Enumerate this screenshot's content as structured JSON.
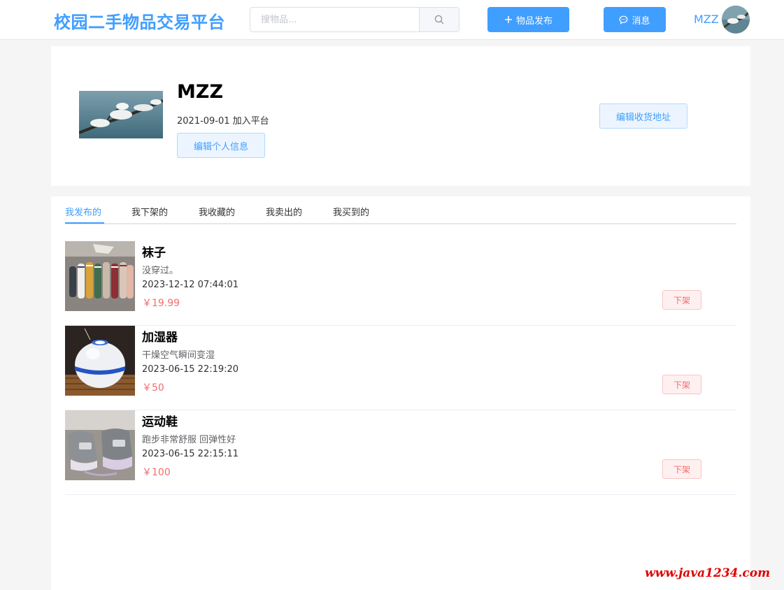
{
  "header": {
    "logo": "校园二手物品交易平台",
    "search_placeholder": "搜物品...",
    "publish_label": "物品发布",
    "message_label": "消息",
    "username": "MZZ"
  },
  "profile": {
    "name": "MZZ",
    "joined": "2021-09-01 加入平台",
    "edit_info_label": "编辑个人信息",
    "edit_address_label": "编辑收货地址"
  },
  "tabs": [
    "我发布的",
    "我下架的",
    "我收藏的",
    "我卖出的",
    "我买到的"
  ],
  "items": [
    {
      "title": "袜子",
      "desc": "没穿过。",
      "time": "2023-12-12 07:44:01",
      "price": "￥19.99",
      "action": "下架"
    },
    {
      "title": "加湿器",
      "desc": "干燥空气瞬间变湿",
      "time": "2023-06-15 22:19:20",
      "price": "￥50",
      "action": "下架"
    },
    {
      "title": "运动鞋",
      "desc": "跑步非常舒服 回弹性好",
      "time": "2023-06-15 22:15:11",
      "price": "￥100",
      "action": "下架"
    }
  ],
  "watermark": "www.java1234.com",
  "colors": {
    "primary": "#409eff",
    "danger": "#f56c6c"
  }
}
